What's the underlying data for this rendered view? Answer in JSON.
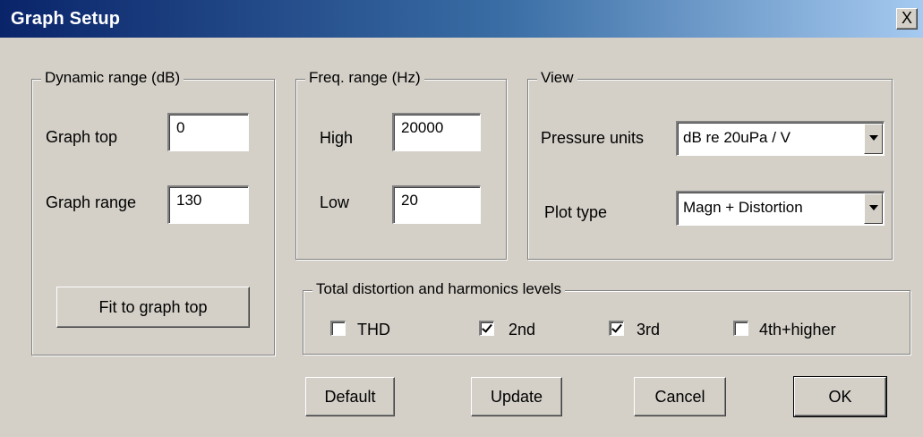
{
  "window": {
    "title": "Graph Setup",
    "close_glyph": "X"
  },
  "dynamic_range": {
    "legend": "Dynamic range (dB)",
    "graph_top_label": "Graph top",
    "graph_top_value": "0",
    "graph_range_label": "Graph range",
    "graph_range_value": "130",
    "fit_button": "Fit to graph top"
  },
  "freq_range": {
    "legend": "Freq. range (Hz)",
    "high_label": "High",
    "high_value": "20000",
    "low_label": "Low",
    "low_value": "20"
  },
  "view": {
    "legend": "View",
    "pressure_units_label": "Pressure units",
    "pressure_units_value": "dB re 20uPa / V",
    "plot_type_label": "Plot type",
    "plot_type_value": "Magn + Distortion"
  },
  "distortion": {
    "legend": "Total distortion and harmonics levels",
    "items": [
      {
        "label": "THD",
        "checked": false
      },
      {
        "label": "2nd",
        "checked": true
      },
      {
        "label": "3rd",
        "checked": true
      },
      {
        "label": "4th+higher",
        "checked": false
      }
    ]
  },
  "buttons": {
    "default": "Default",
    "update": "Update",
    "cancel": "Cancel",
    "ok": "OK"
  },
  "icons": {
    "close": "close-icon",
    "dropdown": "chevron-down-icon"
  },
  "colors": {
    "title_start": "#0a246a",
    "title_end": "#a6caf0",
    "face": "#d4d0c8"
  }
}
